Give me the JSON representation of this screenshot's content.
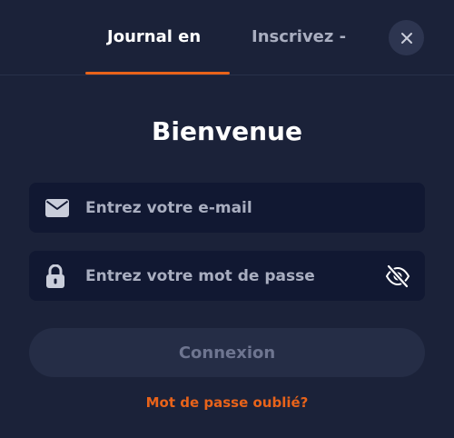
{
  "tabs": [
    {
      "label": "Journal en",
      "active": true
    },
    {
      "label": "Inscrivez -",
      "active": false
    }
  ],
  "close_icon": "close-icon",
  "title": "Bienvenue",
  "form": {
    "email": {
      "placeholder": "Entrez votre e-mail",
      "value": "",
      "icon": "envelope-icon"
    },
    "password": {
      "placeholder": "Entrez votre mot de passe",
      "value": "",
      "icon": "lock-icon",
      "toggle_icon": "eye-off-icon"
    },
    "submit_label": "Connexion",
    "forgot_label": "Mot de passe oublié?"
  },
  "colors": {
    "background": "#1b2239",
    "field_background": "#111832",
    "accent": "#e8631a",
    "button_disabled": "#252d46",
    "text_muted": "#a9aec0"
  }
}
